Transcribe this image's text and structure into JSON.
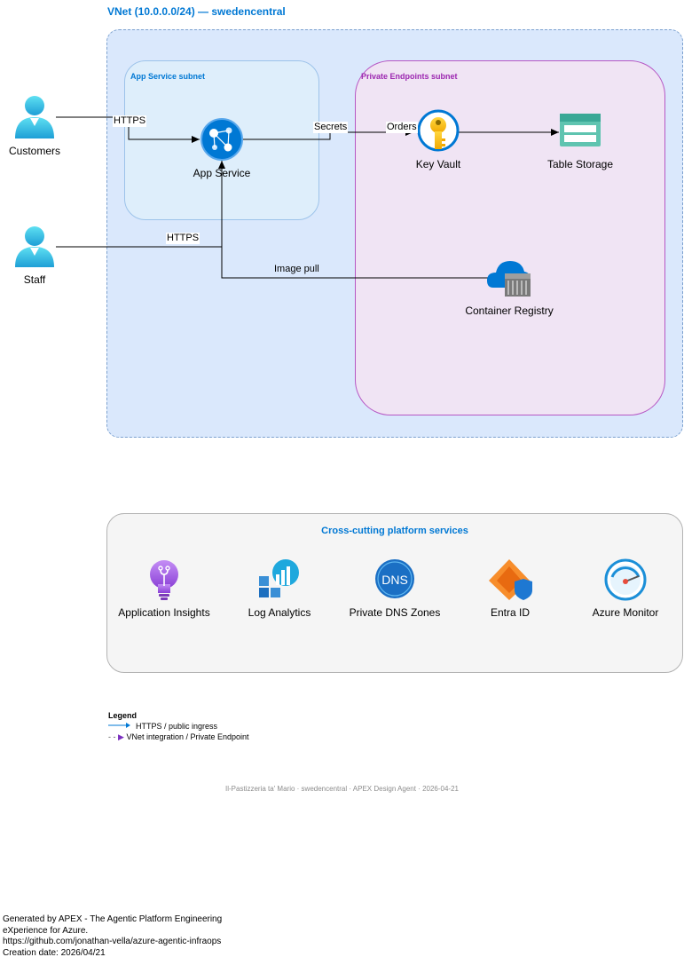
{
  "vnet": {
    "title": "VNet (10.0.0.0/24) — swedencentral",
    "app_subnet": "App Service subnet",
    "pe_subnet": "Private Endpoints subnet"
  },
  "nodes": {
    "customers": "Customers",
    "staff": "Staff",
    "app_service": "App Service",
    "key_vault": "Key Vault",
    "table_storage": "Table Storage",
    "container_registry": "Container Registry"
  },
  "edges": {
    "customers_https": "HTTPS",
    "staff_https": "HTTPS",
    "secrets": "Secrets",
    "orders": "Orders",
    "image_pull": "Image pull"
  },
  "platform": {
    "title": "Cross-cutting platform services",
    "items": [
      "Application Insights",
      "Log Analytics",
      "Private DNS Zones",
      "Entra ID",
      "Azure Monitor"
    ],
    "dns_icon_text": "DNS"
  },
  "legend": {
    "title": "Legend",
    "https": "HTTPS / public ingress",
    "vnet": "VNet integration / Private Endpoint"
  },
  "footer": "Il-Pastizzeria ta' Mario · swedencentral · APEX Design Agent · 2026-04-21",
  "generated": "Generated by APEX - The Agentic Platform Engineering\neXperience for Azure.\nhttps://github.com/jonathan-vella/azure-agentic-infraops\nCreation date: 2026/04/21",
  "colors": {
    "azure_blue": "#0078d4",
    "vnet_fill": "#dae8fc",
    "pe_border": "#b657c4",
    "pe_fill": "#f0e4f4",
    "legend_purple": "#7b2fbf"
  }
}
